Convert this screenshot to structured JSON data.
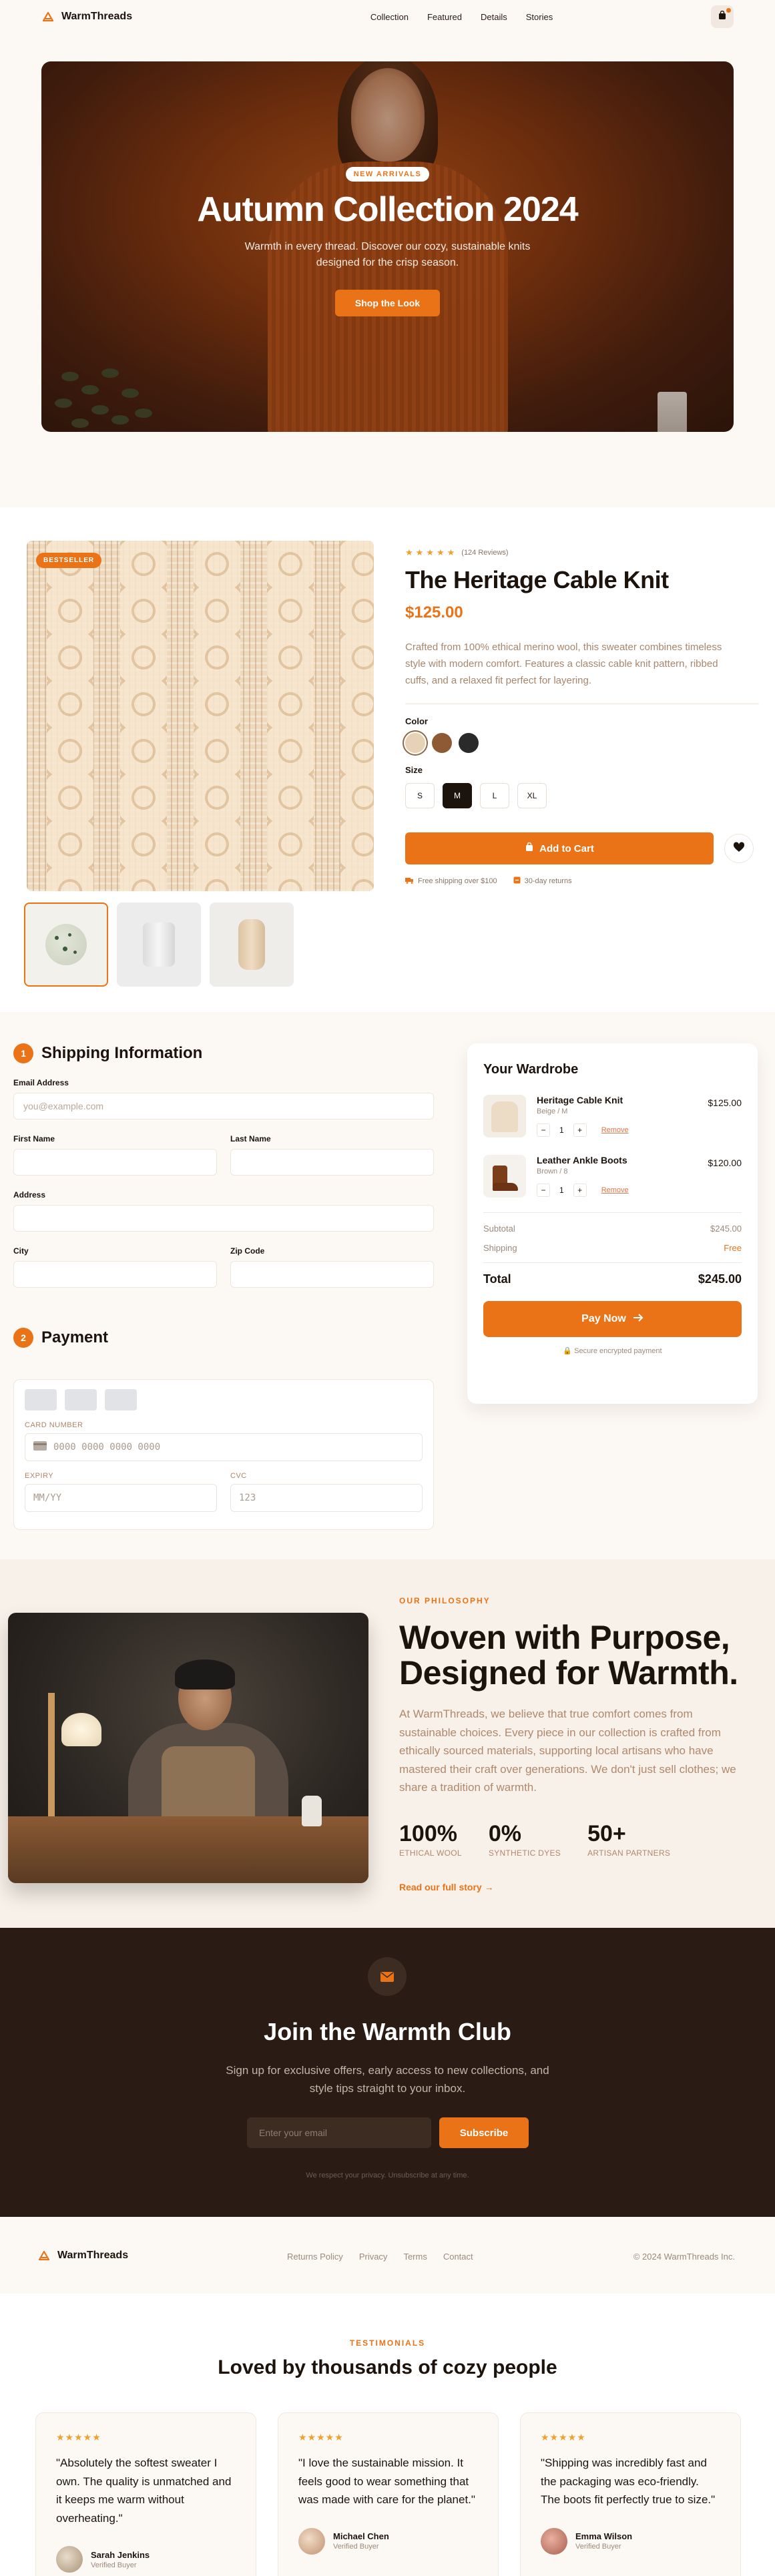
{
  "nav": {
    "brand": "WarmThreads",
    "links": [
      "Collection",
      "Featured",
      "Details",
      "Stories"
    ]
  },
  "hero": {
    "badge": "NEW ARRIVALS",
    "title": "Autumn Collection 2024",
    "subtitle": "Warmth in every thread. Discover our cozy, sustainable knits designed for the crisp season.",
    "cta": "Shop the Look"
  },
  "product": {
    "badge": "BESTSELLER",
    "rating_stars": 5,
    "reviews": "(124 Reviews)",
    "title": "The Heritage Cable Knit",
    "price": "$125.00",
    "description": "Crafted from 100% ethical merino wool, this sweater combines timeless style with modern comfort. Features a classic cable knit pattern, ribbed cuffs, and a relaxed fit perfect for layering.",
    "color_label": "Color",
    "colors": [
      "#e8d2b5",
      "#8d5a35",
      "#2a2a2a"
    ],
    "selected_color": 0,
    "size_label": "Size",
    "sizes": [
      "S",
      "M",
      "L",
      "XL"
    ],
    "selected_size": "M",
    "add_to_cart": "Add to Cart",
    "perks": [
      "Free shipping over $100",
      "30-day returns"
    ]
  },
  "checkout": {
    "shipping_step": "1",
    "shipping_title": "Shipping Information",
    "email_label": "Email Address",
    "email_placeholder": "you@example.com",
    "first_name_label": "First Name",
    "last_name_label": "Last Name",
    "address_label": "Address",
    "city_label": "City",
    "zip_label": "Zip Code",
    "payment_step": "2",
    "payment_title": "Payment",
    "card_number_label": "CARD NUMBER",
    "card_number_placeholder": "0000 0000 0000 0000",
    "expiry_label": "EXPIRY",
    "expiry_placeholder": "MM/YY",
    "cvc_label": "CVC",
    "cvc_placeholder": "123"
  },
  "summary": {
    "title": "Your Wardrobe",
    "items": [
      {
        "name": "Heritage Cable Knit",
        "variant": "Beige / M",
        "qty": "1",
        "price": "$125.00",
        "remove": "Remove"
      },
      {
        "name": "Leather Ankle Boots",
        "variant": "Brown / 8",
        "qty": "1",
        "price": "$120.00",
        "remove": "Remove"
      }
    ],
    "subtotal_label": "Subtotal",
    "subtotal": "$245.00",
    "shipping_label": "Shipping",
    "shipping": "Free",
    "total_label": "Total",
    "total": "$245.00",
    "pay_now": "Pay Now",
    "secure": "Secure encrypted payment"
  },
  "philosophy": {
    "eyebrow": "OUR PHILOSOPHY",
    "title": "Woven with Purpose, Designed for Warmth.",
    "body": "At WarmThreads, we believe that true comfort comes from sustainable choices. Every piece in our collection is crafted from ethically sourced materials, supporting local artisans who have mastered their craft over generations. We don't just sell clothes; we share a tradition of warmth.",
    "stats": [
      {
        "value": "100%",
        "label": "ETHICAL WOOL"
      },
      {
        "value": "0%",
        "label": "SYNTHETIC DYES"
      },
      {
        "value": "50+",
        "label": "ARTISAN PARTNERS"
      }
    ],
    "link": "Read our full story →"
  },
  "club": {
    "title": "Join the Warmth Club",
    "subtitle": "Sign up for exclusive offers, early access to new collections, and style tips straight to your inbox.",
    "input_placeholder": "Enter your email",
    "button": "Subscribe",
    "note": "We respect your privacy. Unsubscribe at any time."
  },
  "footer": {
    "brand": "WarmThreads",
    "links": [
      "Returns Policy",
      "Privacy",
      "Terms",
      "Contact"
    ],
    "copyright": "© 2024 WarmThreads Inc."
  },
  "testimonials": {
    "eyebrow": "TESTIMONIALS",
    "title": "Loved by thousands of cozy people",
    "items": [
      {
        "stars": "★★★★★",
        "quote": "\"Absolutely the softest sweater I own. The quality is unmatched and it keeps me warm without overheating.\"",
        "name": "Sarah Jenkins",
        "role": "Verified Buyer",
        "avatar_color": "#c9b79f"
      },
      {
        "stars": "★★★★★",
        "quote": "\"I love the sustainable mission. It feels good to wear something that was made with care for the planet.\"",
        "name": "Michael Chen",
        "role": "Verified Buyer",
        "avatar_color": "#d9b494"
      },
      {
        "stars": "★★★★★",
        "quote": "\"Shipping was incredibly fast and the packaging was eco-friendly. The boots fit perfectly true to size.\"",
        "name": "Emma Wilson",
        "role": "Verified Buyer",
        "avatar_color": "#c98474"
      }
    ]
  },
  "colors": {
    "accent": "#ea7317",
    "dark": "#2a1c14",
    "cream": "#fcf8f4"
  }
}
